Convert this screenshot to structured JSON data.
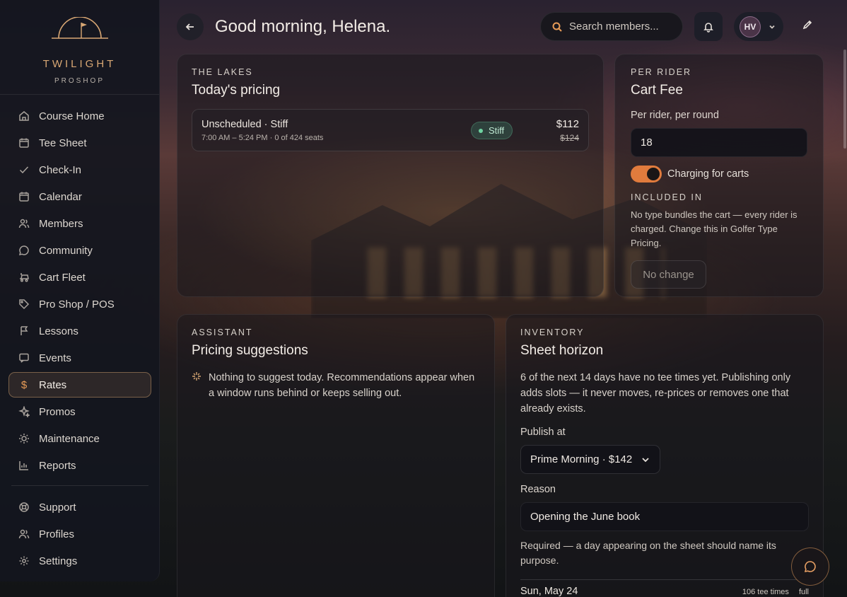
{
  "brand": {
    "name": "TWILIGHT",
    "sub": "PROSHOP"
  },
  "sidebar": {
    "items": [
      {
        "label": "Course Home",
        "icon": "home-icon"
      },
      {
        "label": "Tee Sheet",
        "icon": "calendar-icon"
      },
      {
        "label": "Check-In",
        "icon": "check-icon"
      },
      {
        "label": "Calendar",
        "icon": "calendar-icon"
      },
      {
        "label": "Members",
        "icon": "members-icon"
      },
      {
        "label": "Community",
        "icon": "chat-icon"
      },
      {
        "label": "Cart Fleet",
        "icon": "cart-icon"
      },
      {
        "label": "Pro Shop / POS",
        "icon": "tag-icon"
      },
      {
        "label": "Lessons",
        "icon": "flag-icon"
      },
      {
        "label": "Events",
        "icon": "message-icon"
      },
      {
        "label": "Rates",
        "icon": "dollar-icon",
        "active": true
      },
      {
        "label": "Promos",
        "icon": "sparkle-icon"
      },
      {
        "label": "Maintenance",
        "icon": "sun-icon"
      },
      {
        "label": "Reports",
        "icon": "chart-icon"
      }
    ],
    "footer": [
      {
        "label": "Support",
        "icon": "lifebuoy-icon"
      },
      {
        "label": "Profiles",
        "icon": "members-icon"
      },
      {
        "label": "Settings",
        "icon": "gear-icon"
      }
    ]
  },
  "header": {
    "greeting": "Good morning, Helena.",
    "search_placeholder": "Search members...",
    "user_initials": "HV"
  },
  "pricing_card": {
    "eyebrow": "THE LAKES",
    "title": "Today's pricing",
    "row": {
      "title": "Unscheduled · Stiff",
      "sub": "7:00 AM – 5:24 PM · 0 of 424 seats",
      "badge": "Stiff",
      "price": "$112",
      "old_price": "$124"
    }
  },
  "cart_fee_card": {
    "eyebrow": "PER RIDER",
    "title": "Cart Fee",
    "field_label": "Per rider, per round",
    "field_value": "18",
    "toggle_label": "Charging for carts",
    "toggle_on": true,
    "included_label": "INCLUDED IN",
    "included_note": "No type bundles the cart — every rider is charged. Change this in Golfer Type Pricing.",
    "button": "No change"
  },
  "assistant_card": {
    "eyebrow": "ASSISTANT",
    "title": "Pricing suggestions",
    "message": "Nothing to suggest today. Recommendations appear when a window runs behind or keeps selling out."
  },
  "inventory_card": {
    "eyebrow": "INVENTORY",
    "title": "Sheet horizon",
    "description": "6 of the next 14 days have no tee times yet. Publishing only adds slots — it never moves, re-prices or removes one that already exists.",
    "publish_label": "Publish at",
    "publish_value": "Prime Morning · $142",
    "reason_label": "Reason",
    "reason_value": "Opening the June book",
    "hint": "Required — a day appearing on the sheet should name its purpose.",
    "day": {
      "date": "Sun, May 24",
      "tee_times": "106 tee times",
      "status": "full"
    }
  },
  "colors": {
    "accent": "#e07b3d",
    "brand": "#d8a774",
    "success": "#6fd3a1"
  }
}
